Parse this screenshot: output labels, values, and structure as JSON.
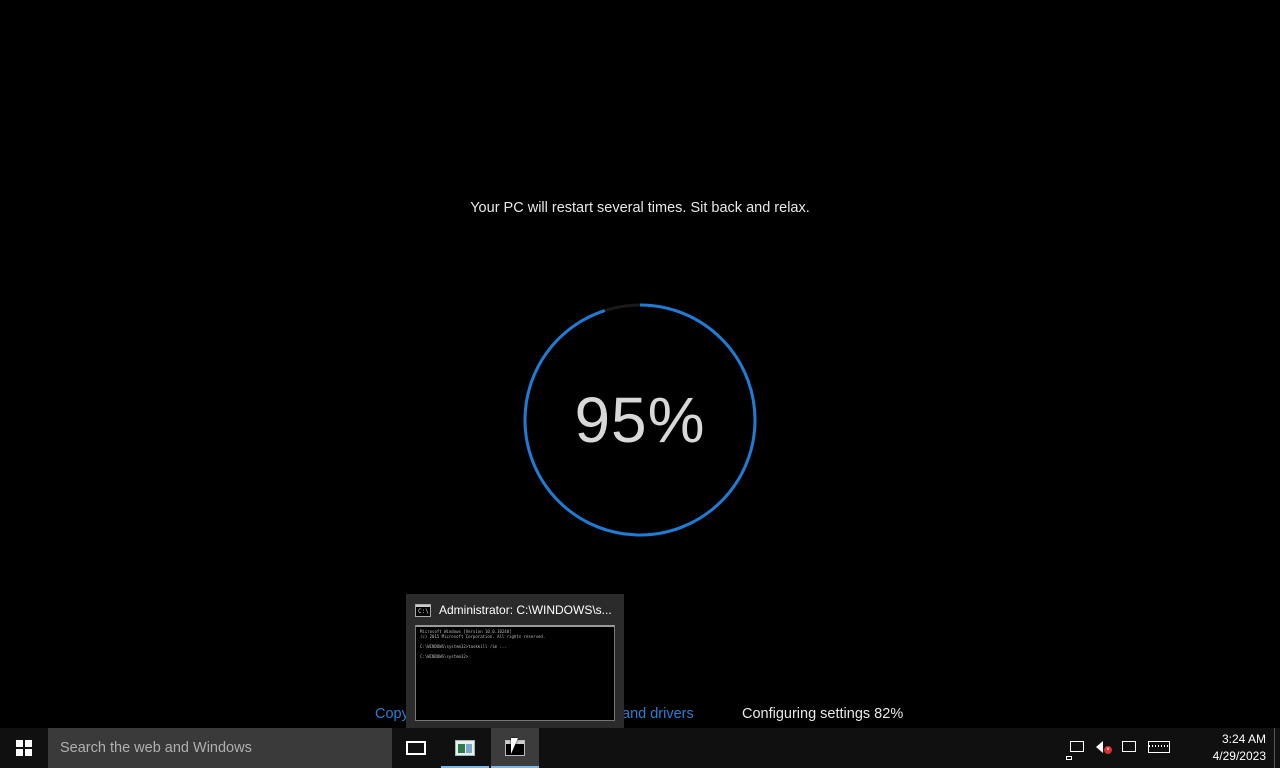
{
  "setup": {
    "headline": "Your PC will restart several times. Sit back and relax.",
    "progress_percent_label": "95%",
    "progress_fraction": 0.95,
    "accent_color": "#1e7cd6",
    "steps": {
      "copying_label": "Copy",
      "drivers_label": "and drivers",
      "configuring_label": "Configuring settings 82%"
    }
  },
  "preview": {
    "title": "Administrator: C:\\WINDOWS\\s...",
    "icon": "cmd-icon",
    "console_lines": [
      "Microsoft Windows [Version 10.0.10240]",
      "(c) 2015 Microsoft Corporation. All rights reserved.",
      "",
      "C:\\WINDOWS\\system32>taskkill /im ...",
      "",
      "C:\\WINDOWS\\system32>"
    ]
  },
  "taskbar": {
    "search_placeholder": "Search the web and Windows",
    "clock_time": "3:24 AM",
    "clock_date": "4/29/2023",
    "icons": [
      "windows-start-icon",
      "task-view-icon",
      "tv-app-icon",
      "command-prompt-icon",
      "network-icon",
      "volume-muted-icon",
      "action-center-icon",
      "keyboard-icon"
    ]
  }
}
